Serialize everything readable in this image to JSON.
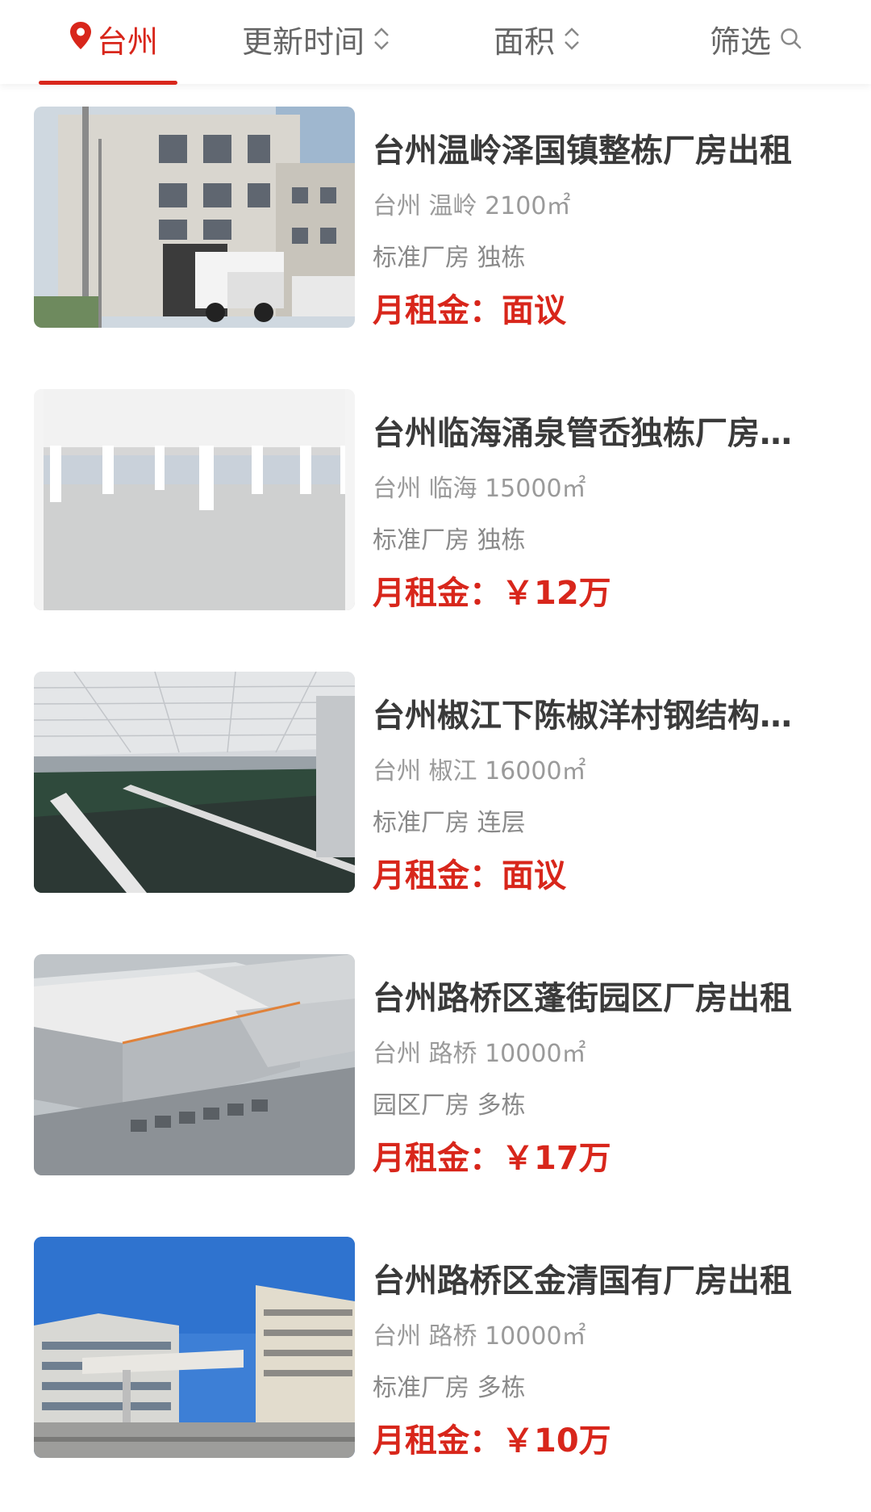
{
  "topbar": {
    "city": "台州",
    "sort_time": "更新时间",
    "sort_area": "面积",
    "filter": "筛选"
  },
  "listings": [
    {
      "title": "台州温岭泽国镇整栋厂房出租",
      "city": "台州",
      "district": "温岭",
      "area": "2100㎡",
      "tags": "标准厂房 独栋",
      "price_label": "月租金：",
      "price": "面议"
    },
    {
      "title": "台州临海涌泉管岙独栋厂房出租",
      "city": "台州",
      "district": "临海",
      "area": "15000㎡",
      "tags": "标准厂房 独栋",
      "price_label": "月租金：",
      "price": "￥12万"
    },
    {
      "title": "台州椒江下陈椒洋村钢结构厂房",
      "city": "台州",
      "district": "椒江",
      "area": "16000㎡",
      "tags": "标准厂房 连层",
      "price_label": "月租金：",
      "price": "面议"
    },
    {
      "title": "台州路桥区蓬街园区厂房出租",
      "city": "台州",
      "district": "路桥",
      "area": "10000㎡",
      "tags": "园区厂房 多栋",
      "price_label": "月租金：",
      "price": "￥17万"
    },
    {
      "title": "台州路桥区金清国有厂房出租",
      "city": "台州",
      "district": "路桥",
      "area": "10000㎡",
      "tags": "标准厂房 多栋",
      "price_label": "月租金：",
      "price": "￥10万"
    }
  ],
  "icons": {
    "location": "location-pin-icon",
    "sort": "sort-updown-icon",
    "search": "search-icon"
  },
  "colors": {
    "accent": "#d8261b",
    "title": "#3a3a3a",
    "meta": "#9a9a9a"
  }
}
